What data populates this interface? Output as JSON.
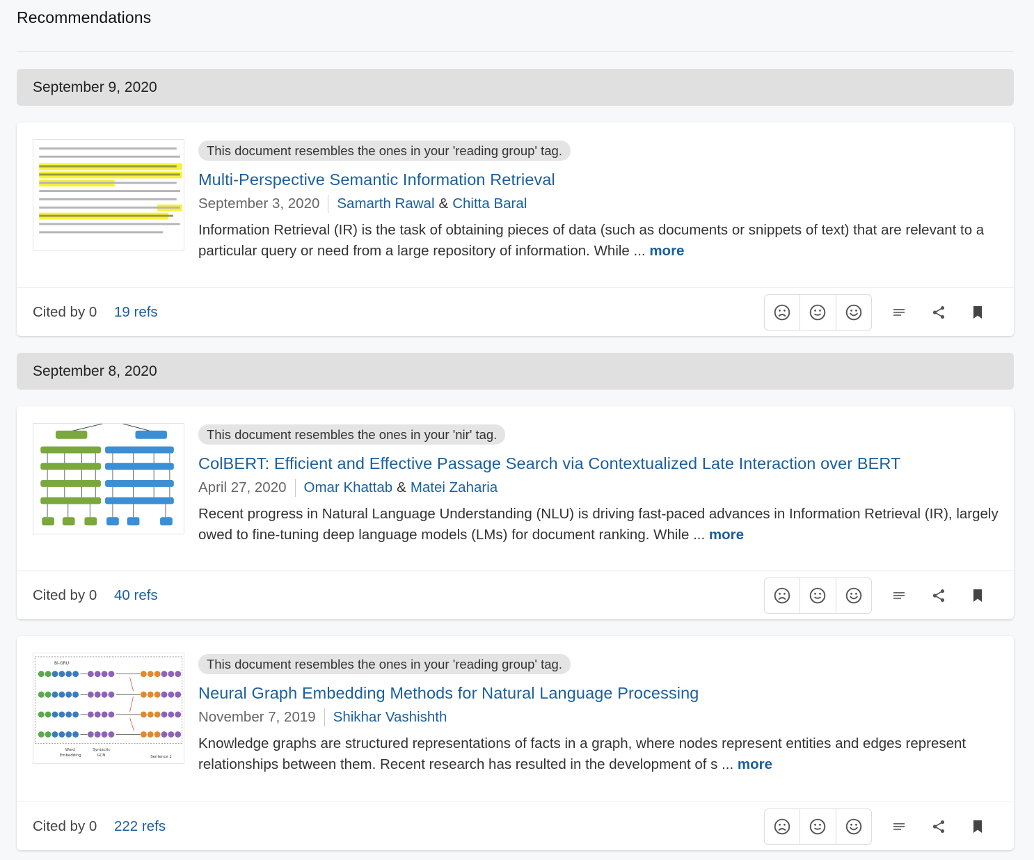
{
  "page": {
    "title": "Recommendations"
  },
  "groups": [
    {
      "date": "September 9, 2020",
      "papers": [
        {
          "tag_note": "This document resembles the ones in your 'reading group' tag.",
          "title": "Multi-Perspective Semantic Information Retrieval",
          "pub_date": "September 3, 2020",
          "authors": [
            "Samarth Rawal",
            "Chitta Baral"
          ],
          "abstract": "Information Retrieval (IR) is the task of obtaining pieces of data (such as documents or snippets of text) that are relevant to a particular query or need from a large repository of information. While ...",
          "more_label": "more",
          "cited_by": "Cited by 0",
          "refs": "19 refs"
        }
      ]
    },
    {
      "date": "September 8, 2020",
      "papers": [
        {
          "tag_note": "This document resembles the ones in your 'nir' tag.",
          "title": "ColBERT: Efficient and Effective Passage Search via Contextualized Late Interaction over BERT",
          "pub_date": "April 27, 2020",
          "authors": [
            "Omar Khattab",
            "Matei Zaharia"
          ],
          "abstract": "Recent progress in Natural Language Understanding (NLU) is driving fast-paced advances in Information Retrieval (IR), largely owed to fine-tuning deep language models (LMs) for document ranking. While ...",
          "more_label": "more",
          "cited_by": "Cited by 0",
          "refs": "40 refs"
        },
        {
          "tag_note": "This document resembles the ones in your 'reading group' tag.",
          "title": "Neural Graph Embedding Methods for Natural Language Processing",
          "pub_date": "November 7, 2019",
          "authors": [
            "Shikhar Vashishth"
          ],
          "abstract": "Knowledge graphs are structured representations of facts in a graph, where nodes represent entities and edges represent relationships between them. Recent research has resulted in the development of s ...",
          "more_label": "more",
          "cited_by": "Cited by 0",
          "refs": "222 refs"
        }
      ]
    }
  ],
  "icons": {
    "feedback": [
      "sad-face-icon",
      "neutral-face-icon",
      "happy-face-icon"
    ],
    "actions": [
      "notes-icon",
      "share-icon",
      "bookmark-icon"
    ]
  },
  "thumbnail_labels": {
    "graph": [
      "Bi-GRU",
      "Word",
      "Syntactic",
      "Sentence 1",
      "GCN",
      "Embedding"
    ]
  },
  "colors": {
    "link": "#1a5f9e",
    "highlight": "#f6f23a",
    "colbert_green": "#7aa83c",
    "colbert_blue": "#3a8fd6"
  }
}
